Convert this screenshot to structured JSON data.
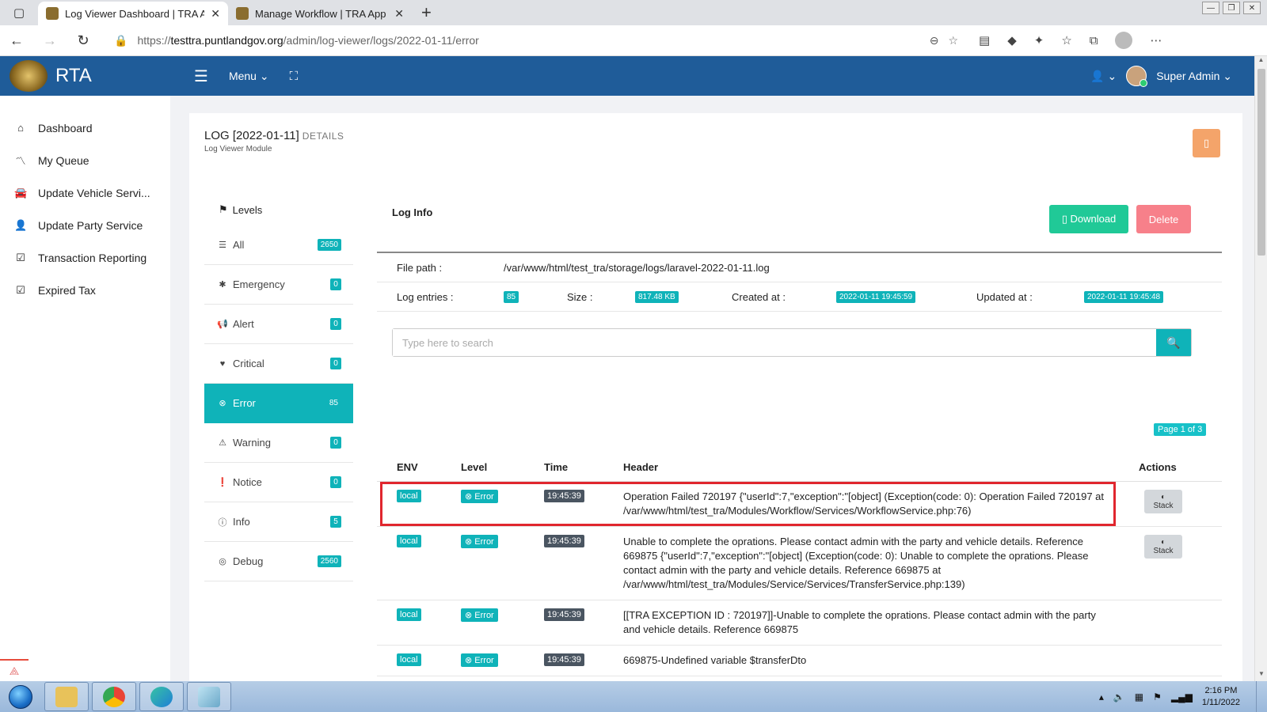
{
  "browser": {
    "tabs": [
      {
        "title": "Log Viewer Dashboard | TRA App",
        "active": true
      },
      {
        "title": "Manage Workflow | TRA App",
        "active": false
      }
    ],
    "url_prefix": "https://",
    "url_host": "testtra.puntlandgov.org",
    "url_path": "/admin/log-viewer/logs/2022-01-11/error"
  },
  "app": {
    "brand": "RTA",
    "menu_label": "Menu",
    "user_name": "Super Admin"
  },
  "sidebar": {
    "items": [
      {
        "label": "Dashboard",
        "icon": "home-icon"
      },
      {
        "label": "My Queue",
        "icon": "trend-icon"
      },
      {
        "label": "Update Vehicle Servi...",
        "icon": "car-icon"
      },
      {
        "label": "Update Party Service",
        "icon": "user-icon"
      },
      {
        "label": "Transaction Reporting",
        "icon": "check-square-icon"
      },
      {
        "label": "Expired Tax",
        "icon": "check-square-icon"
      }
    ]
  },
  "page": {
    "title": "LOG [2022-01-11]",
    "title_suffix": "DETAILS",
    "subtitle": "Log Viewer Module",
    "orange_btn": "▯"
  },
  "levels": {
    "heading": "Levels",
    "items": [
      {
        "label": "All",
        "count": "2650",
        "icon": "list-icon",
        "active": false
      },
      {
        "label": "Emergency",
        "count": "0",
        "icon": "bug-icon",
        "active": false
      },
      {
        "label": "Alert",
        "count": "0",
        "icon": "bullhorn-icon",
        "active": false
      },
      {
        "label": "Critical",
        "count": "0",
        "icon": "heartbeat-icon",
        "active": false
      },
      {
        "label": "Error",
        "count": "85",
        "icon": "times-circle-icon",
        "active": true
      },
      {
        "label": "Warning",
        "count": "0",
        "icon": "warning-icon",
        "active": false
      },
      {
        "label": "Notice",
        "count": "0",
        "icon": "exclamation-circle-icon",
        "active": false
      },
      {
        "label": "Info",
        "count": "5",
        "icon": "info-circle-icon",
        "active": false
      },
      {
        "label": "Debug",
        "count": "2560",
        "icon": "life-ring-icon",
        "active": false
      }
    ]
  },
  "loginfo": {
    "title": "Log Info",
    "download_label": "▯ Download",
    "delete_label": "Delete",
    "file_path_label": "File path :",
    "file_path": "/var/www/html/test_tra/storage/logs/laravel-2022-01-11.log",
    "entries_label": "Log entries :",
    "entries": "85",
    "size_label": "Size :",
    "size": "817.48 KB",
    "created_label": "Created at :",
    "created": "2022-01-11 19:45:59",
    "updated_label": "Updated at :",
    "updated": "2022-01-11 19:45:48",
    "search_placeholder": "Type here to search",
    "page_badge": "Page 1 of 3"
  },
  "entries_table": {
    "headers": {
      "env": "ENV",
      "level": "Level",
      "time": "Time",
      "header": "Header",
      "actions": "Actions"
    },
    "stack_label": "Stack",
    "rows": [
      {
        "env": "local",
        "level": "Error",
        "time": "19:45:39",
        "header": "Operation Failed 720197 {\"userId\":7,\"exception\":\"[object] (Exception(code: 0): Operation Failed 720197 at /var/www/html/test_tra/Modules/Workflow/Services/WorkflowService.php:76)",
        "stack": true
      },
      {
        "env": "local",
        "level": "Error",
        "time": "19:45:39",
        "header": "Unable to complete the oprations. Please contact admin with the party and vehicle details. Reference 669875 {\"userId\":7,\"exception\":\"[object] (Exception(code: 0): Unable to complete the oprations. Please contact admin with the party and vehicle details. Reference 669875 at /var/www/html/test_tra/Modules/Service/Services/TransferService.php:139)",
        "stack": true
      },
      {
        "env": "local",
        "level": "Error",
        "time": "19:45:39",
        "header": "[[TRA EXCEPTION ID : 720197]]-Unable to complete the oprations. Please contact admin with the party and vehicle details. Reference 669875",
        "stack": false
      },
      {
        "env": "local",
        "level": "Error",
        "time": "19:45:39",
        "header": "669875-Undefined variable $transferDto",
        "stack": false
      }
    ]
  },
  "taskbar": {
    "time": "2:16 PM",
    "date": "1/11/2022"
  }
}
